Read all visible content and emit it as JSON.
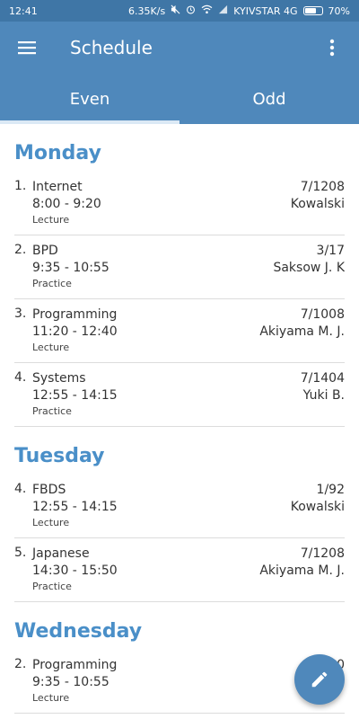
{
  "status": {
    "time": "12:41",
    "speed": "6.35K/s",
    "carrier": "KYIVSTAR 4G",
    "battery_label": "70%",
    "battery_level": 0.7
  },
  "app_bar": {
    "title": "Schedule"
  },
  "tabs": [
    {
      "label": "Even",
      "active": true
    },
    {
      "label": "Odd",
      "active": false
    }
  ],
  "days": [
    {
      "name": "Monday",
      "lessons": [
        {
          "num": "1.",
          "subject": "Internet",
          "time": "8:00 - 9:20",
          "type": "Lecture",
          "room": "7/1208",
          "teacher": "Kowalski"
        },
        {
          "num": "2.",
          "subject": "BPD",
          "time": "9:35 - 10:55",
          "type": "Practice",
          "room": "3/17",
          "teacher": "Saksow J. K"
        },
        {
          "num": "3.",
          "subject": "Programming",
          "time": "11:20 - 12:40",
          "type": "Lecture",
          "room": "7/1008",
          "teacher": "Akiyama M. J."
        },
        {
          "num": "4.",
          "subject": "Systems",
          "time": "12:55 - 14:15",
          "type": "Practice",
          "room": "7/1404",
          "teacher": "Yuki B."
        }
      ]
    },
    {
      "name": "Tuesday",
      "lessons": [
        {
          "num": "4.",
          "subject": "FBDS",
          "time": "12:55 - 14:15",
          "type": "Lecture",
          "room": "1/92",
          "teacher": "Kowalski"
        },
        {
          "num": "5.",
          "subject": "Japanese",
          "time": "14:30 - 15:50",
          "type": "Practice",
          "room": "7/1208",
          "teacher": "Akiyama M. J."
        }
      ]
    },
    {
      "name": "Wednesday",
      "lessons": [
        {
          "num": "2.",
          "subject": "Programming",
          "time": "9:35 - 10:55",
          "type": "Lecture",
          "room": "…10",
          "teacher": ""
        }
      ]
    }
  ],
  "icons": {
    "menu": "menu-icon",
    "more": "more-vert-icon",
    "fab": "edit-pencil-icon"
  },
  "colors": {
    "primary": "#4f88bb",
    "status_bar": "#3f76a6",
    "day_header": "#4a8fc8"
  }
}
